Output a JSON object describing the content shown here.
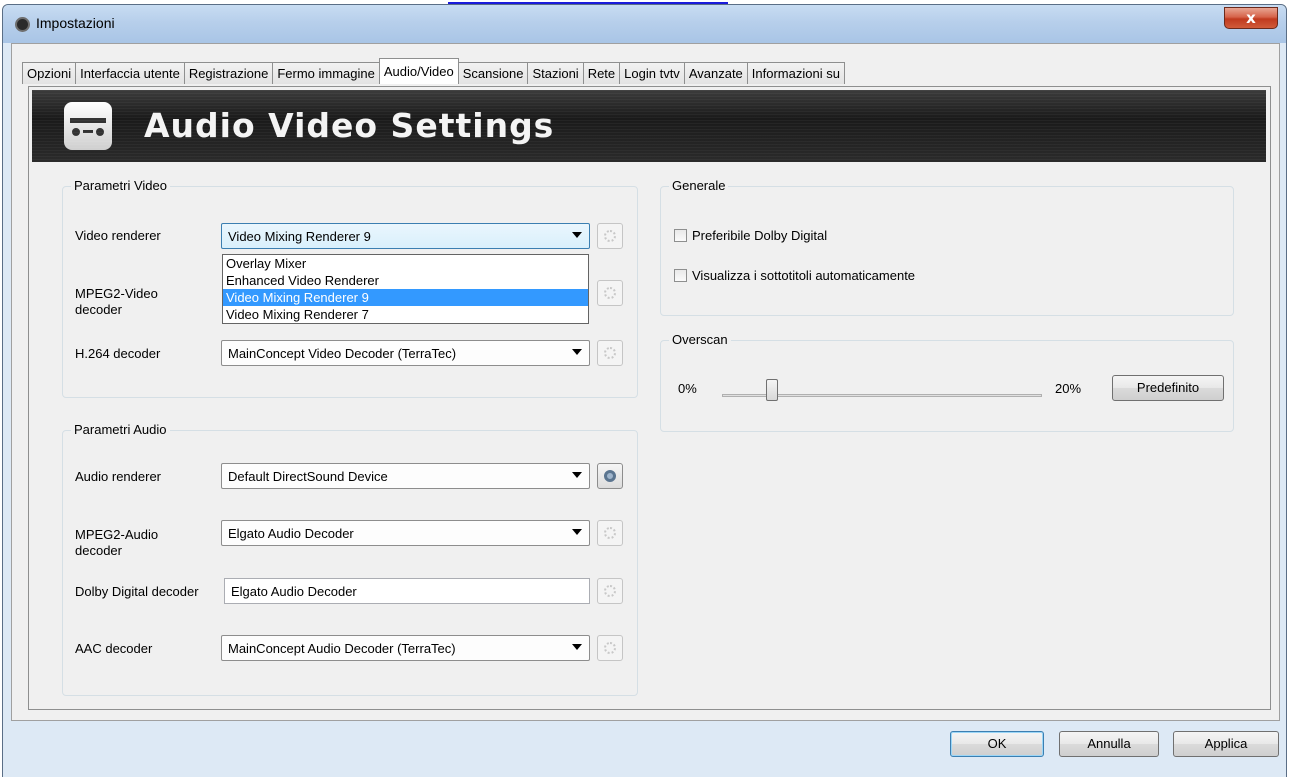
{
  "window": {
    "title": "Impostazioni",
    "close_label": "x"
  },
  "tabs": [
    {
      "label": "Opzioni"
    },
    {
      "label": "Interfaccia utente"
    },
    {
      "label": "Registrazione"
    },
    {
      "label": "Fermo immagine"
    },
    {
      "label": "Audio/Video",
      "active": true
    },
    {
      "label": "Scansione"
    },
    {
      "label": "Stazioni"
    },
    {
      "label": "Rete"
    },
    {
      "label": "Login tvtv"
    },
    {
      "label": "Avanzate"
    },
    {
      "label": "Informazioni su"
    }
  ],
  "banner": {
    "title": "Audio Video Settings",
    "icon": "audio-video-icon"
  },
  "video_params": {
    "legend": "Parametri Video",
    "video_renderer_label": "Video renderer",
    "video_renderer_value": "Video Mixing Renderer 9",
    "video_renderer_options": [
      "Overlay Mixer",
      "Enhanced Video Renderer",
      "Video Mixing Renderer 9",
      "Video Mixing Renderer 7"
    ],
    "mpeg2_video_label": "MPEG2-Video decoder",
    "h264_label": "H.264 decoder",
    "h264_value": "MainConcept Video Decoder (TerraTec)"
  },
  "audio_params": {
    "legend": "Parametri Audio",
    "audio_renderer_label": "Audio renderer",
    "audio_renderer_value": "Default DirectSound Device",
    "mpeg2_audio_label": "MPEG2-Audio decoder",
    "mpeg2_audio_value": "Elgato Audio Decoder",
    "dolby_label": "Dolby Digital decoder",
    "dolby_value": "Elgato Audio Decoder",
    "aac_label": "AAC decoder",
    "aac_value": "MainConcept Audio Decoder (TerraTec)"
  },
  "general": {
    "legend": "Generale",
    "prefer_dolby_label": "Preferibile Dolby Digital",
    "prefer_dolby_checked": false,
    "subtitles_label": "Visualizza i sottotitoli automaticamente",
    "subtitles_checked": false
  },
  "overscan": {
    "legend": "Overscan",
    "min_label": "0%",
    "max_label": "20%",
    "default_button": "Predefinito"
  },
  "footer": {
    "ok": "OK",
    "cancel": "Annulla",
    "apply": "Applica"
  },
  "colors": {
    "selection": "#3399ff",
    "banner_bg": "#1a1a1a"
  }
}
